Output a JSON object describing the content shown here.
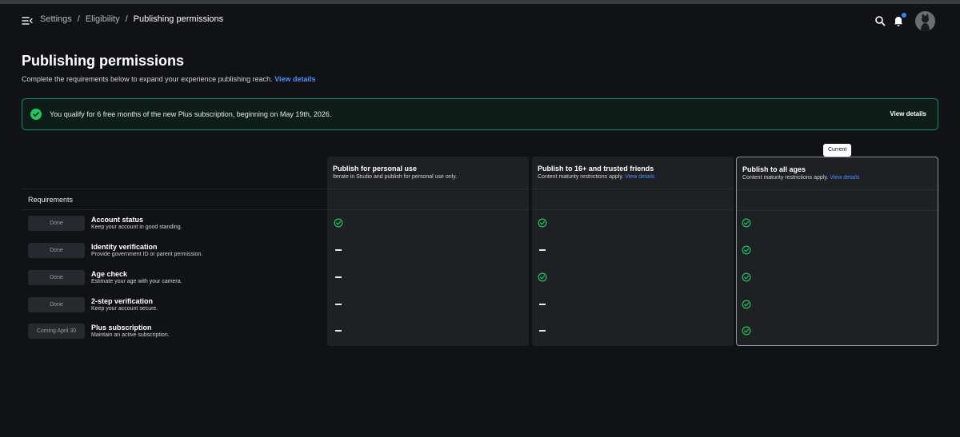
{
  "breadcrumbs": [
    "Settings",
    "Eligibility",
    "Publishing permissions"
  ],
  "page": {
    "title": "Publishing permissions",
    "subtitle": "Complete the requirements below to expand your experience publishing reach.",
    "subtitle_link": "View details"
  },
  "banner": {
    "message": "You qualify for 6 free months of the new Plus subscription, beginning on May 19th, 2026.",
    "link": "View details"
  },
  "requirements_heading": "Requirements",
  "current_tag": "Current",
  "columns": [
    {
      "title": "Publish for personal use",
      "desc": "Iterate in Studio and publish for personal use only.",
      "link": ""
    },
    {
      "title": "Publish to 16+ and trusted friends",
      "desc": "Content maturity restrictions apply.",
      "link": "View details"
    },
    {
      "title": "Publish to all ages",
      "desc": "Content maturity restrictions apply.",
      "link": "View details"
    }
  ],
  "rows": [
    {
      "badge": "Done",
      "title": "Account status",
      "desc": "Keep your account in good standing.",
      "cells": [
        "check",
        "check",
        "check"
      ]
    },
    {
      "badge": "Done",
      "title": "Identity verification",
      "desc": "Provide government ID or parent permission.",
      "cells": [
        "dash",
        "dash",
        "check"
      ]
    },
    {
      "badge": "Done",
      "title": "Age check",
      "desc": "Estimate your age with your camera.",
      "cells": [
        "dash",
        "check",
        "check"
      ]
    },
    {
      "badge": "Done",
      "title": "2-step verification",
      "desc": "Keep your account secure.",
      "cells": [
        "dash",
        "dash",
        "check"
      ]
    },
    {
      "badge": "Coming April 30",
      "title": "Plus subscription",
      "desc": "Maintain an active subscription.",
      "cells": [
        "dash",
        "dash",
        "check"
      ]
    }
  ],
  "colors": {
    "accent": "#4c8dff",
    "success": "#22c55e",
    "background": "#111216",
    "notification": "#3b82f6"
  },
  "icons": {
    "menu": "menu-collapse-icon",
    "search": "search-icon",
    "notifications": "bell-icon",
    "check": "check-circle-icon"
  }
}
